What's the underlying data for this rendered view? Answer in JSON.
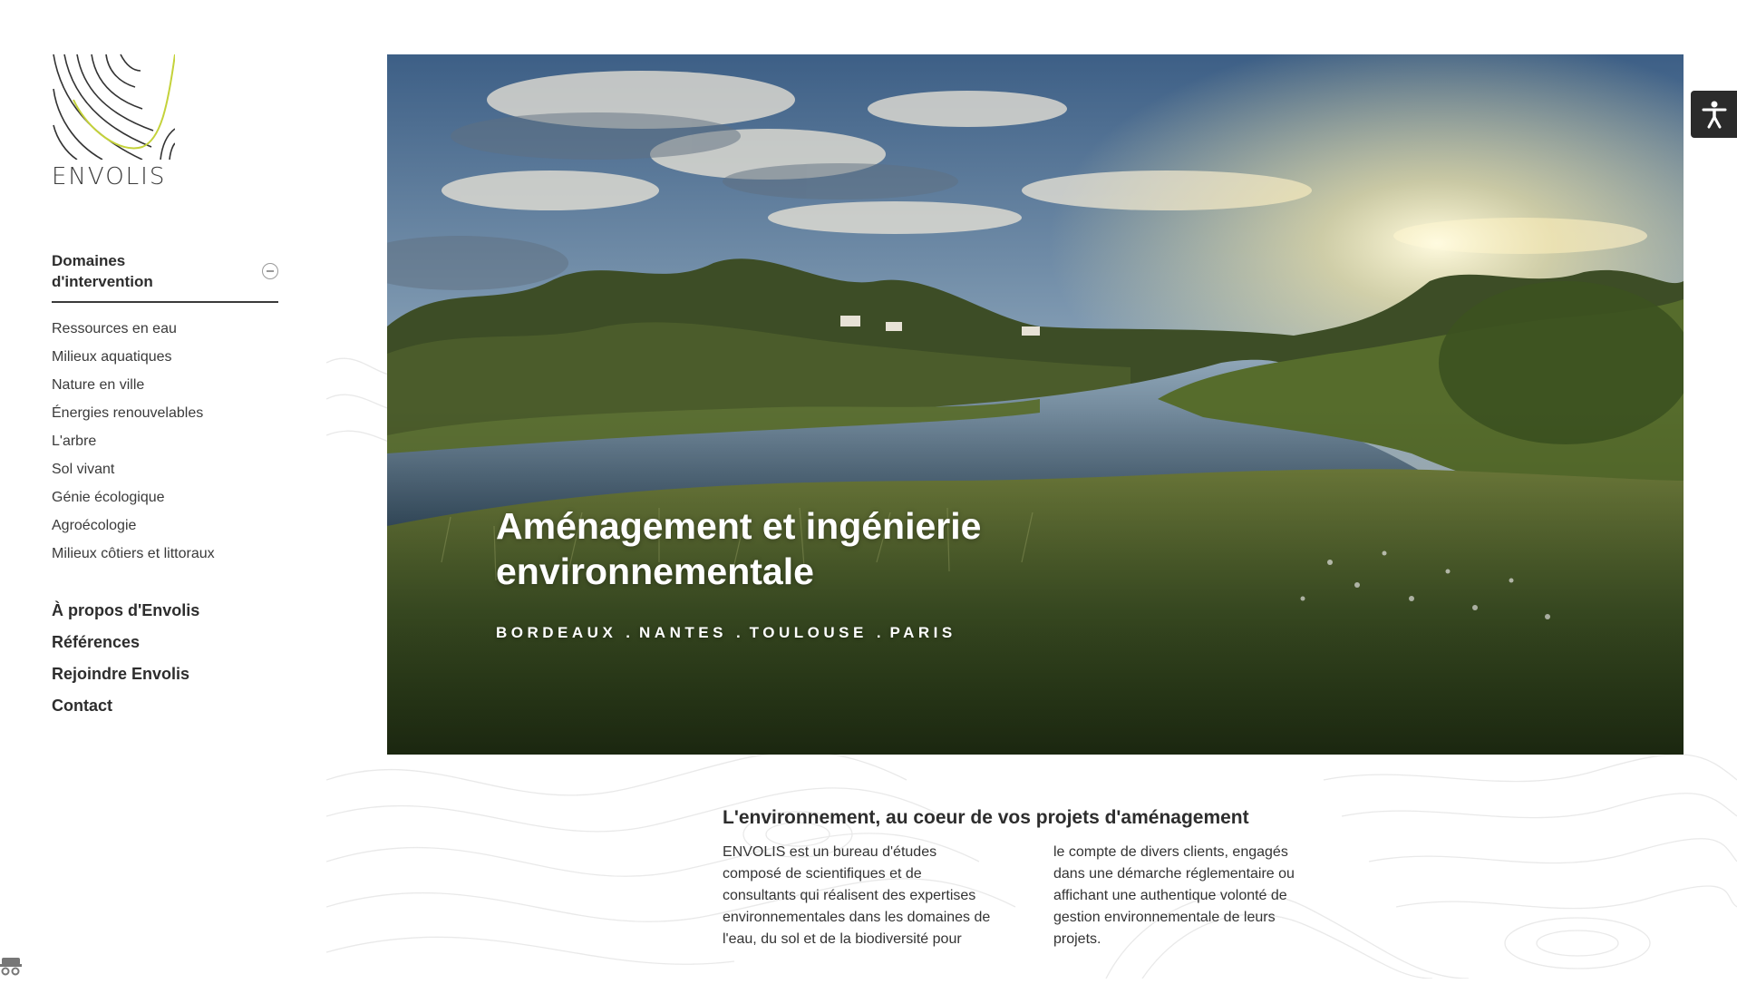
{
  "logo": {
    "text": "ENVOLIS"
  },
  "sidebar": {
    "section_title": "Domaines d'intervention",
    "sub_items": [
      "Ressources en eau",
      "Milieux aquatiques",
      "Nature en ville",
      "Énergies renouvelables",
      "L'arbre",
      "Sol vivant",
      "Génie écologique",
      "Agroécologie",
      "Milieux côtiers et littoraux"
    ],
    "main_items": [
      "À propos d'Envolis",
      "Références",
      "Rejoindre Envolis",
      "Contact"
    ]
  },
  "hero": {
    "title": "Aménagement et ingénierie environnementale",
    "cities": [
      "BORDEAUX",
      "NANTES",
      "TOULOUSE",
      "PARIS"
    ],
    "city_separator": "."
  },
  "intro": {
    "heading": "L'environnement, au coeur de vos projets d'aménagement",
    "col_left": "ENVOLIS est un bureau d'études composé de scientifiques et de consultants qui réalisent des expertises environnementales dans les domaines de l'eau, du sol et de la biodiversité pour",
    "col_right": "le compte de divers clients, engagés dans une démarche réglementaire ou affichant une authentique volonté de gestion environnementale de leurs projets."
  },
  "icons": {
    "accessibility": "accessibility-icon",
    "collapse": "minus-circle-icon",
    "cookie": "cookie-icon"
  },
  "colors": {
    "accent_green": "#c4d23a",
    "text_dark": "#2d2d2d",
    "a11y_bg": "#2b2b2b"
  }
}
